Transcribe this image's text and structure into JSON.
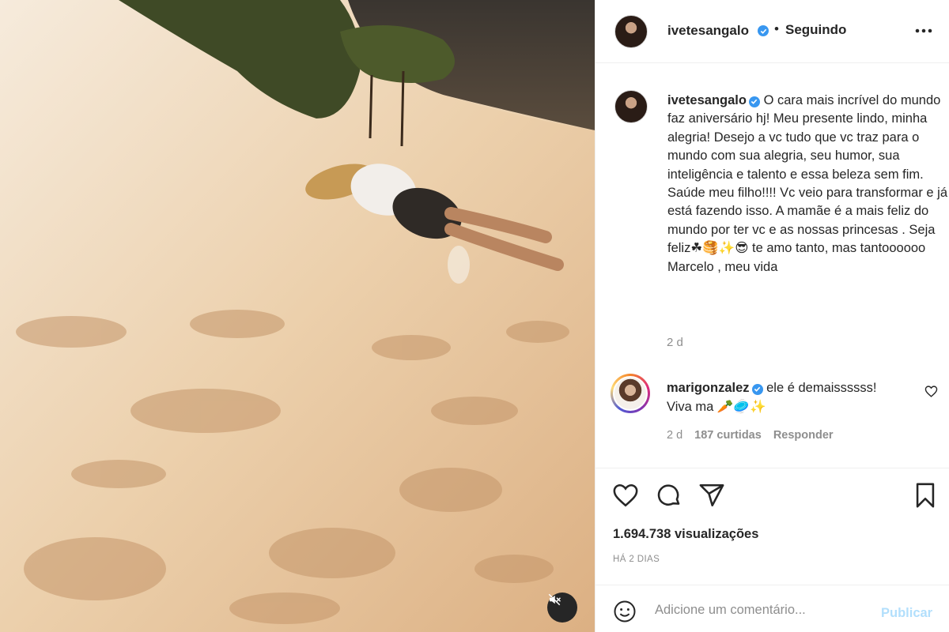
{
  "post": {
    "author": "ivetesangalo",
    "follow_status": "Seguindo",
    "dot": "•",
    "caption": "O cara mais incrível do mundo faz aniversário hj! Meu presente lindo, minha alegria! Desejo a vc tudo que vc traz para o mundo com sua alegria, seu humor, sua inteligência e talento e essa beleza sem fim. Saúde meu filho!!!! Vc veio para transformar e já está fazendo isso. A mamãe é a mais feliz do mundo por ter vc e as nossas princesas . Seja feliz☘🥞✨😎 te amo tanto, mas tantoooooo\nMarcelo , meu vida",
    "age": "2 d"
  },
  "comment": {
    "author": "marigonzalez",
    "text": "ele é demaissssss!",
    "text_line2": "Viva ma 🥕🥏✨",
    "age": "2 d",
    "likes": "187 curtidas",
    "reply": "Responder"
  },
  "stats": {
    "views": "1.694.738 visualizações",
    "ago": "HÁ 2 DIAS"
  },
  "composer": {
    "placeholder": "Adicione um comentário...",
    "publish": "Publicar"
  },
  "icons": {
    "more": "more-horizontal-icon",
    "verified": "verified-badge-icon",
    "like": "heart-icon",
    "comment": "comment-bubble-icon",
    "share": "paper-plane-icon",
    "save": "bookmark-icon",
    "emoji": "smiley-icon",
    "mute": "speaker-muted-icon"
  },
  "colors": {
    "verified": "#3897f0",
    "secondary_text": "#8e8e8e",
    "publish_disabled": "#b2dffc"
  }
}
